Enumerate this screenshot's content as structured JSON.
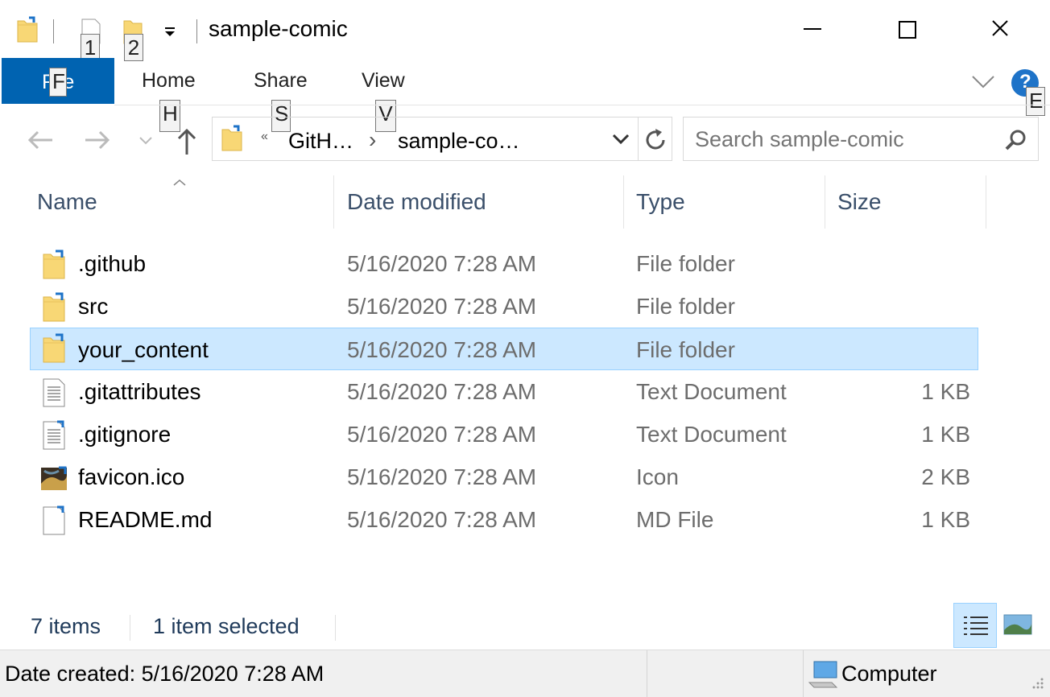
{
  "titlebar": {
    "title": "sample-comic",
    "keytip_1": "1",
    "keytip_2": "2",
    "minimize": "—",
    "maximize": "☐",
    "close": "✕"
  },
  "ribbon": {
    "file_label": "File",
    "file_keytip": "F",
    "tabs": [
      {
        "label": "Home",
        "keytip": "H"
      },
      {
        "label": "Share",
        "keytip": "S"
      },
      {
        "label": "View",
        "keytip": "V"
      }
    ],
    "help_keytip": "E"
  },
  "addressbar": {
    "overflow": "«",
    "crumbs": [
      "GitH…",
      "sample-co…"
    ],
    "separator": "›"
  },
  "search": {
    "placeholder": "Search sample-comic"
  },
  "columns": {
    "name": "Name",
    "date": "Date modified",
    "type": "Type",
    "size": "Size"
  },
  "files": [
    {
      "name": ".github",
      "date": "5/16/2020 7:28 AM",
      "type": "File folder",
      "size": "",
      "icon": "folder-icon",
      "selected": false
    },
    {
      "name": "src",
      "date": "5/16/2020 7:28 AM",
      "type": "File folder",
      "size": "",
      "icon": "folder-icon",
      "selected": false
    },
    {
      "name": "your_content",
      "date": "5/16/2020 7:28 AM",
      "type": "File folder",
      "size": "",
      "icon": "folder-icon",
      "selected": true
    },
    {
      "name": ".gitattributes",
      "date": "5/16/2020 7:28 AM",
      "type": "Text Document",
      "size": "1 KB",
      "icon": "text-file-icon",
      "selected": false
    },
    {
      "name": ".gitignore",
      "date": "5/16/2020 7:28 AM",
      "type": "Text Document",
      "size": "1 KB",
      "icon": "text-file-icon",
      "selected": false
    },
    {
      "name": "favicon.ico",
      "date": "5/16/2020 7:28 AM",
      "type": "Icon",
      "size": "2 KB",
      "icon": "image-thumbnail-icon",
      "selected": false
    },
    {
      "name": "README.md",
      "date": "5/16/2020 7:28 AM",
      "type": "MD File",
      "size": "1 KB",
      "icon": "blank-file-icon",
      "selected": false
    }
  ],
  "statusbar": {
    "item_count": "7 items",
    "selection": "1 item selected"
  },
  "details_bar": {
    "date_created": "Date created: 5/16/2020 7:28 AM",
    "location": "Computer"
  },
  "colors": {
    "accent": "#0063b1",
    "selection": "#cce8ff",
    "header_text": "#3a4f6a"
  }
}
